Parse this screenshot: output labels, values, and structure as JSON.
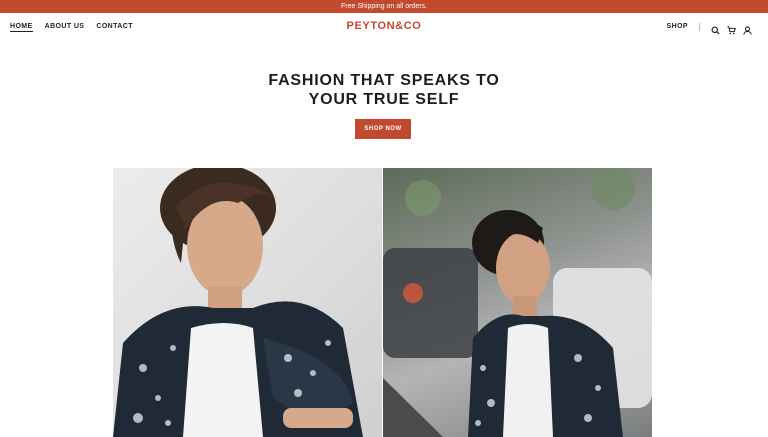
{
  "announcement": "Free Shipping on all orders.",
  "nav": {
    "links": [
      "HOME",
      "ABOUT US",
      "CONTACT"
    ],
    "logo": "PEYTON&CO",
    "shop": "SHOP",
    "icons": [
      "search-icon",
      "cart-icon",
      "account-icon"
    ]
  },
  "hero": {
    "title_line1": "FASHION THAT SPEAKS TO",
    "title_line2": "YOUR TRUE SELF",
    "cta": "SHOP NOW"
  },
  "colors": {
    "brand": "#c14a2e",
    "text": "#1f1f1f"
  }
}
